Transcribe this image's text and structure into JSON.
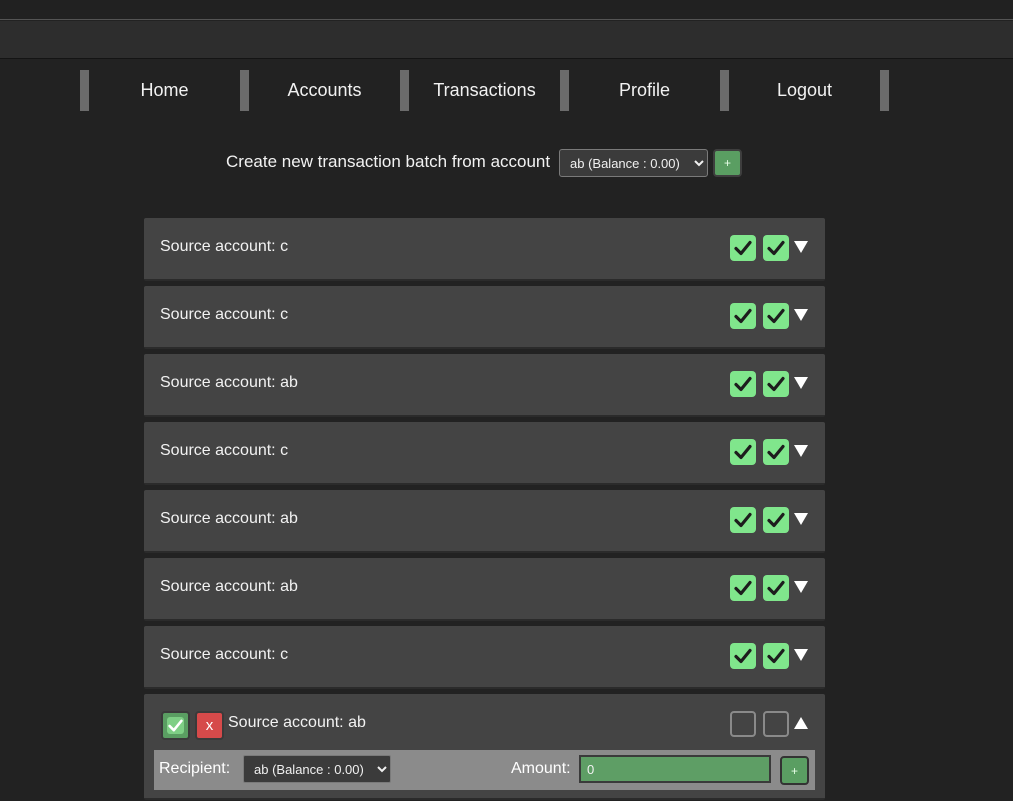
{
  "nav": {
    "items": [
      {
        "label": "Home"
      },
      {
        "label": "Accounts"
      },
      {
        "label": "Transactions"
      },
      {
        "label": "Profile"
      },
      {
        "label": "Logout"
      }
    ]
  },
  "create": {
    "label": "Create new transaction batch from account",
    "selected_account": "ab (Balance : 0.00)",
    "add_label": "+"
  },
  "batches": [
    {
      "source_label": "Source account: c",
      "check1": true,
      "check2": true,
      "expanded": false
    },
    {
      "source_label": "Source account: c",
      "check1": true,
      "check2": true,
      "expanded": false
    },
    {
      "source_label": "Source account: ab",
      "check1": true,
      "check2": true,
      "expanded": false
    },
    {
      "source_label": "Source account: c",
      "check1": true,
      "check2": true,
      "expanded": false
    },
    {
      "source_label": "Source account: ab",
      "check1": true,
      "check2": true,
      "expanded": false
    },
    {
      "source_label": "Source account: ab",
      "check1": true,
      "check2": true,
      "expanded": false
    },
    {
      "source_label": "Source account: c",
      "check1": true,
      "check2": true,
      "expanded": false
    },
    {
      "source_label": "Source account: ab",
      "check1": false,
      "check2": false,
      "expanded": true,
      "delete_label": "x",
      "transaction": {
        "recipient_label": "Recipient:",
        "recipient_selected": "ab (Balance : 0.00)",
        "amount_label": "Amount:",
        "amount_value": "0",
        "add_label": "+"
      }
    }
  ],
  "colors": {
    "background": "#222222",
    "panel": "#444444",
    "check_green": "#80e68c",
    "button_green": "#5a9e62",
    "danger_red": "#d64a4a"
  },
  "icons": {
    "check": "check-icon",
    "collapse": "triangle-down-icon",
    "expand": "triangle-up-icon"
  }
}
